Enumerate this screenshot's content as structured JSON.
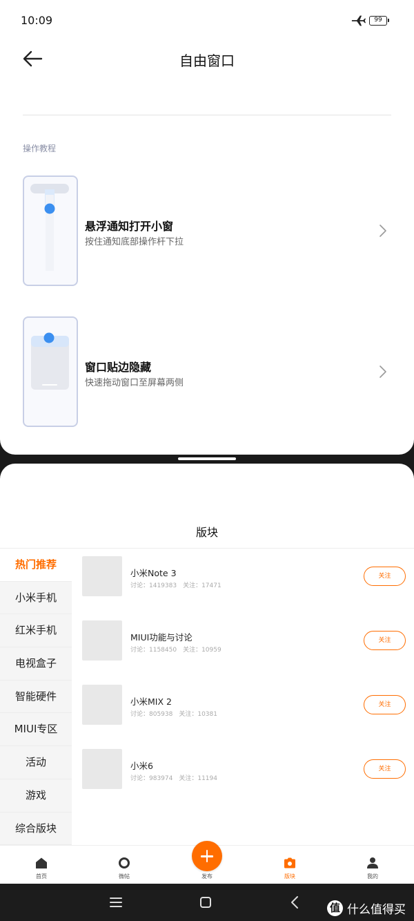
{
  "status_bar": {
    "time": "10:09",
    "battery": "99",
    "airplane_icon": "airplane-icon",
    "battery_icon": "battery-icon"
  },
  "settings": {
    "title": "自由窗口",
    "back_icon": "arrow-left-icon",
    "section_label": "操作教程",
    "tutorials": [
      {
        "title": "悬浮通知打开小窗",
        "desc": "按住通知底部操作杆下拉",
        "icon": "chevron-right-icon"
      },
      {
        "title": "窗口贴边隐藏",
        "desc": "快速拖动窗口至屏幕两侧",
        "icon": "chevron-right-icon"
      }
    ]
  },
  "app": {
    "title": "版块",
    "categories": [
      {
        "label": "热门推荐",
        "active": true
      },
      {
        "label": "小米手机",
        "active": false
      },
      {
        "label": "红米手机",
        "active": false
      },
      {
        "label": "电视盒子",
        "active": false
      },
      {
        "label": "智能硬件",
        "active": false
      },
      {
        "label": "MIUI专区",
        "active": false
      },
      {
        "label": "活动",
        "active": false
      },
      {
        "label": "游戏",
        "active": false
      },
      {
        "label": "综合版块",
        "active": false
      }
    ],
    "forums": [
      {
        "name": "小米Note 3",
        "stats": "讨论：1419383　关注：17471",
        "follow_label": "关注"
      },
      {
        "name": "MIUI功能与讨论",
        "stats": "讨论：1158450　关注：10959",
        "follow_label": "关注"
      },
      {
        "name": "小米MIX 2",
        "stats": "讨论：805938　关注：10381",
        "follow_label": "关注"
      },
      {
        "name": "小米6",
        "stats": "讨论：983974　关注：11194",
        "follow_label": "关注"
      }
    ],
    "tabs": [
      {
        "label": "首页",
        "icon": "home-icon",
        "active": false
      },
      {
        "label": "微帖",
        "icon": "circle-icon",
        "active": false
      },
      {
        "label": "发布",
        "icon": "plus-icon",
        "active": false
      },
      {
        "label": "版块",
        "icon": "camera-icon",
        "active": true
      },
      {
        "label": "我的",
        "icon": "person-icon",
        "active": false
      }
    ]
  },
  "system_nav": {
    "menu_icon": "menu-icon",
    "home_icon": "square-icon",
    "back_icon": "back-chevron-icon"
  },
  "watermark": {
    "badge": "值",
    "text": "什么值得买"
  },
  "colors": {
    "accent": "#ff6d00",
    "thumb_border": "#c8cfe6",
    "dot_blue": "#3b8ff0",
    "nav_bg": "#1c1c1c"
  }
}
